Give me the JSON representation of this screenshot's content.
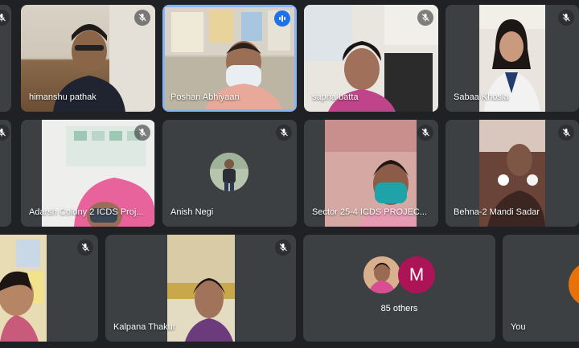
{
  "participants": [
    {
      "name": "",
      "muted": true
    },
    {
      "name": "himanshu pathak",
      "muted": true
    },
    {
      "name": "Poshan Abhiyaan",
      "muted": false,
      "speaking": true
    },
    {
      "name": "sapna batta",
      "muted": true
    },
    {
      "name": "Sabaa Khosla",
      "muted": true
    },
    {
      "name": "",
      "muted": true
    },
    {
      "name": "Adarsh Colony 2 ICDS Proj...",
      "muted": true
    },
    {
      "name": "Anish Negi",
      "muted": true
    },
    {
      "name": "Sector 25-4 ICDS PROJEC...",
      "muted": true
    },
    {
      "name": "Behna-2 Mandi Sadar",
      "muted": true
    },
    {
      "name": "",
      "muted": true
    },
    {
      "name": "Kalpana Thakur",
      "muted": true
    },
    {
      "name": "You",
      "muted": false
    }
  ],
  "others": {
    "count_label": "85 others",
    "avatar_letter": "M",
    "avatar_color": "#ad1457"
  },
  "colors": {
    "tile_bg": "#3c4043",
    "page_bg": "#202124",
    "active_border": "#8ab4f8",
    "speaking_badge": "#1a73e8",
    "self_avatar": "#e8710a"
  }
}
